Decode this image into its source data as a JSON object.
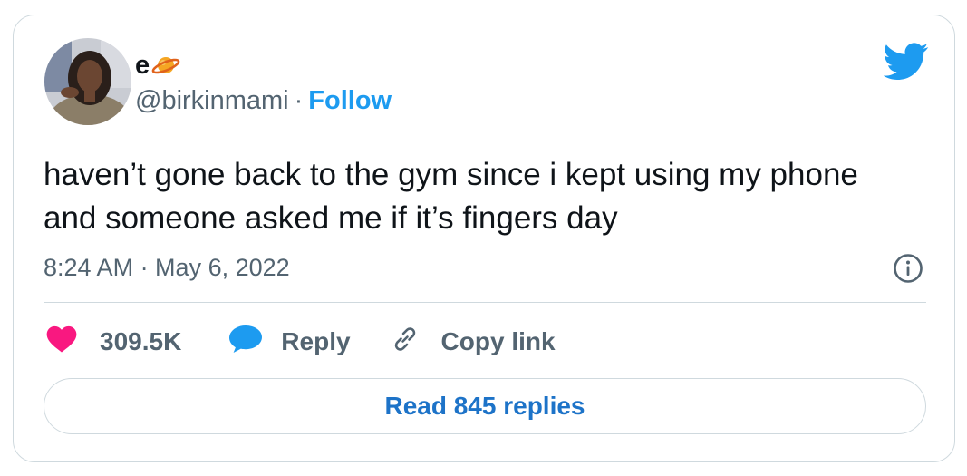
{
  "author": {
    "display_name": "e",
    "handle": "@birkinmami",
    "separator": "·",
    "follow_label": "Follow",
    "name_emoji": "ringed-planet-icon"
  },
  "tweet": {
    "text": "haven’t gone back to the gym since i kept using my phone and someone asked me if it’s fingers day",
    "timestamp": "8:24 AM · May 6, 2022"
  },
  "actions": {
    "likes_count": "309.5K",
    "reply_label": "Reply",
    "copy_link_label": "Copy link"
  },
  "footer": {
    "read_replies_label": "Read 845 replies"
  },
  "icons": {
    "brand": "twitter-bird-icon",
    "info": "info-icon",
    "like": "heart-icon",
    "reply": "speech-bubble-icon",
    "copy": "link-icon"
  },
  "colors": {
    "brand_blue": "#1d9bf0",
    "like_pink": "#f91880",
    "text_primary": "#0f1419",
    "text_secondary": "#536471",
    "border": "#cfd9de",
    "read_replies_text": "#1d73c8"
  }
}
